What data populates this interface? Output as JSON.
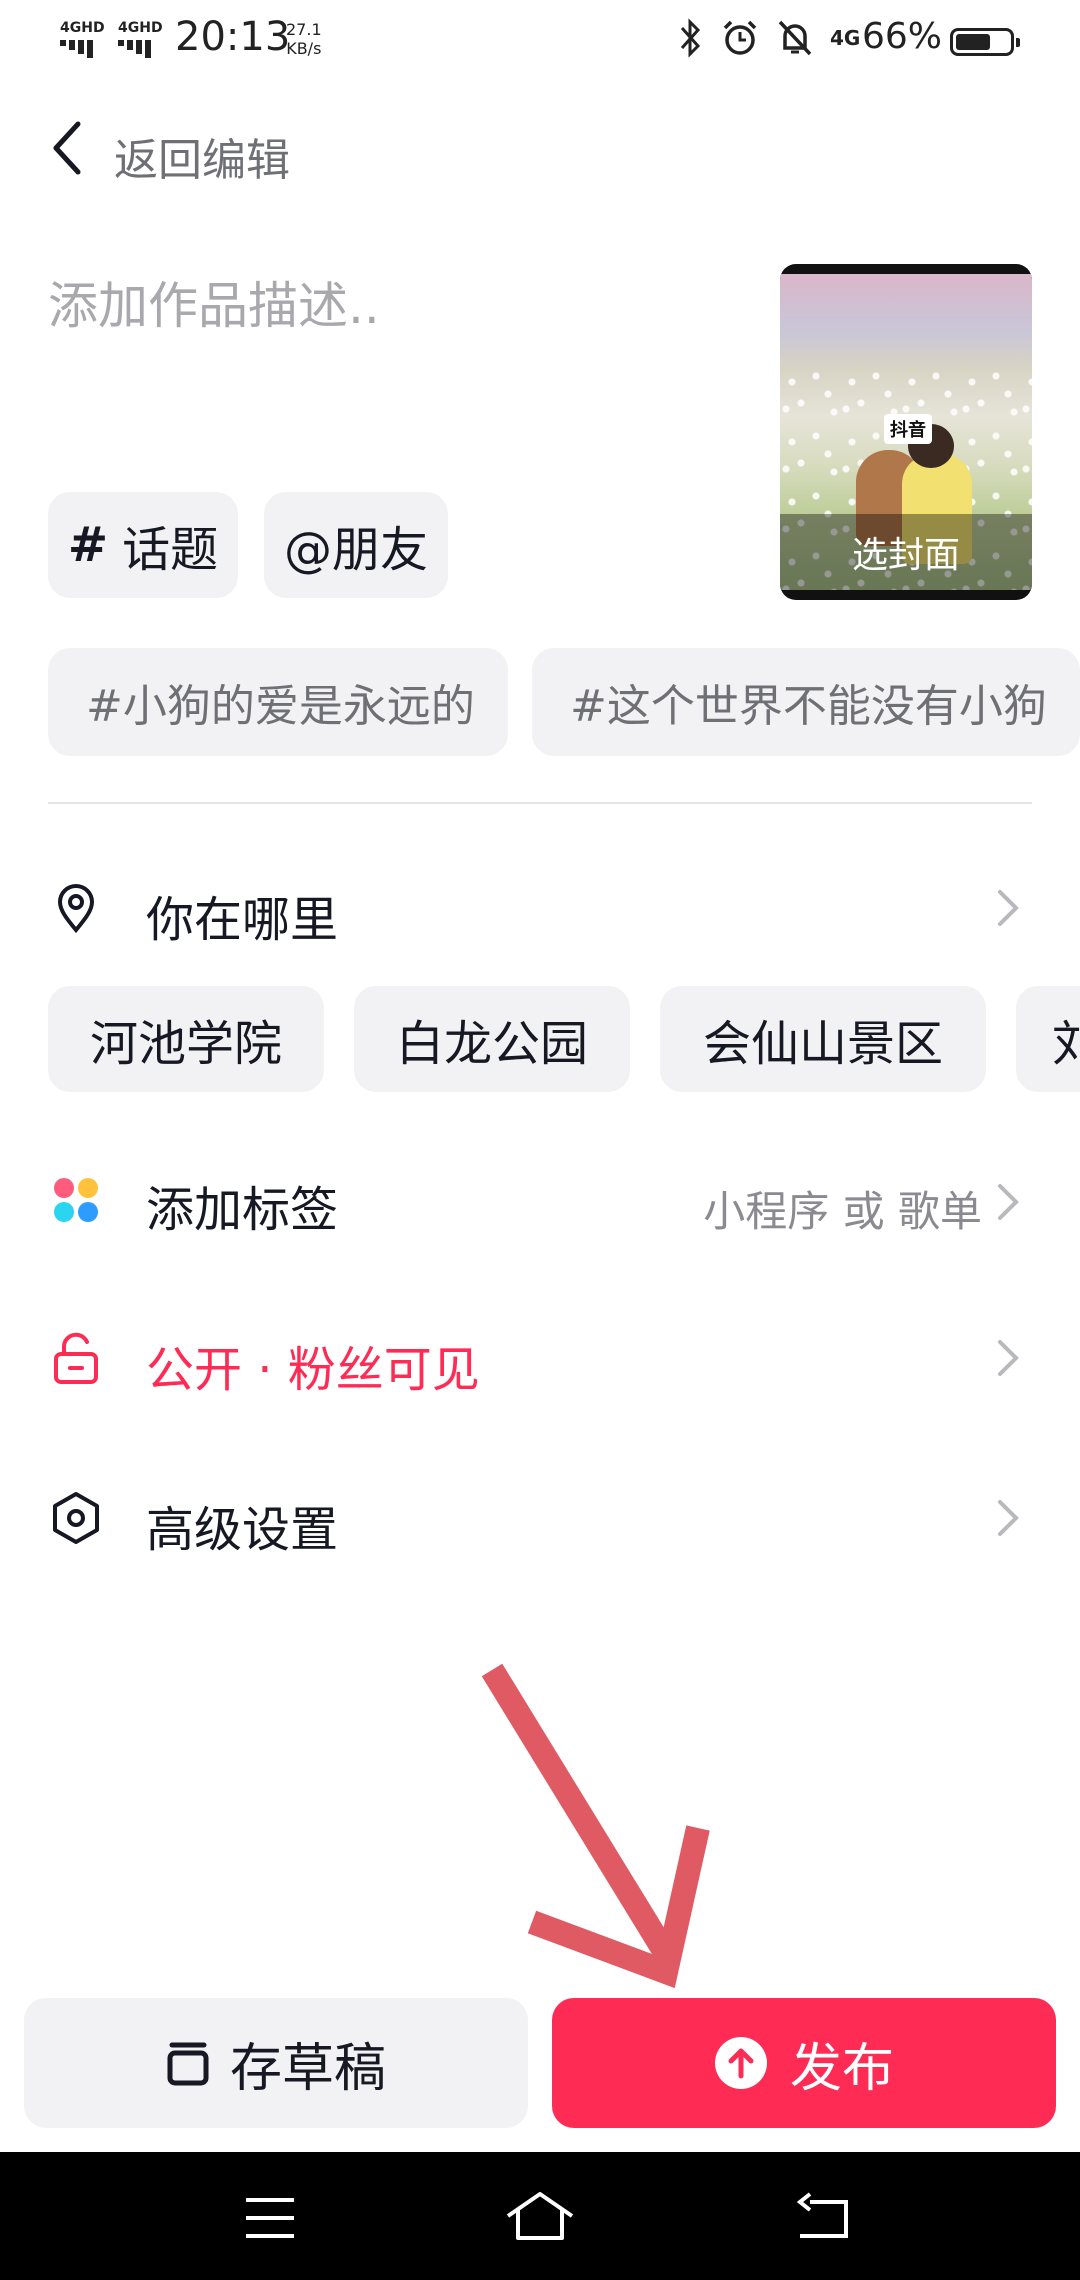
{
  "status_bar": {
    "signal1": "4GHD",
    "signal2": "4GHD",
    "time": "20:13",
    "speed_value": "27.1",
    "speed_unit": "KB/s",
    "network": "4G",
    "battery_percent": "66%",
    "battery_level": 0.66
  },
  "header": {
    "back_label": "返回编辑"
  },
  "description": {
    "placeholder": "添加作品描述.."
  },
  "cover": {
    "label": "选封面",
    "watermark": "抖音"
  },
  "chips": {
    "topic_symbol": "#",
    "topic": "话题",
    "friend": "@朋友"
  },
  "suggested_tags": [
    "#小狗的爱是永远的",
    "#这个世界不能没有小狗"
  ],
  "location": {
    "label": "你在哪里",
    "suggestions": [
      "河池学院",
      "白龙公园",
      "会仙山景区",
      "刘"
    ]
  },
  "add_tag": {
    "label": "添加标签",
    "hint": "小程序 或 歌单"
  },
  "visibility": {
    "label": "公开 · 粉丝可见"
  },
  "advanced": {
    "label": "高级设置"
  },
  "actions": {
    "draft": "存草稿",
    "publish": "发布"
  },
  "colors": {
    "accent": "#fe2c55",
    "arrow": "#e05a64",
    "chip_bg": "#f2f2f4"
  }
}
